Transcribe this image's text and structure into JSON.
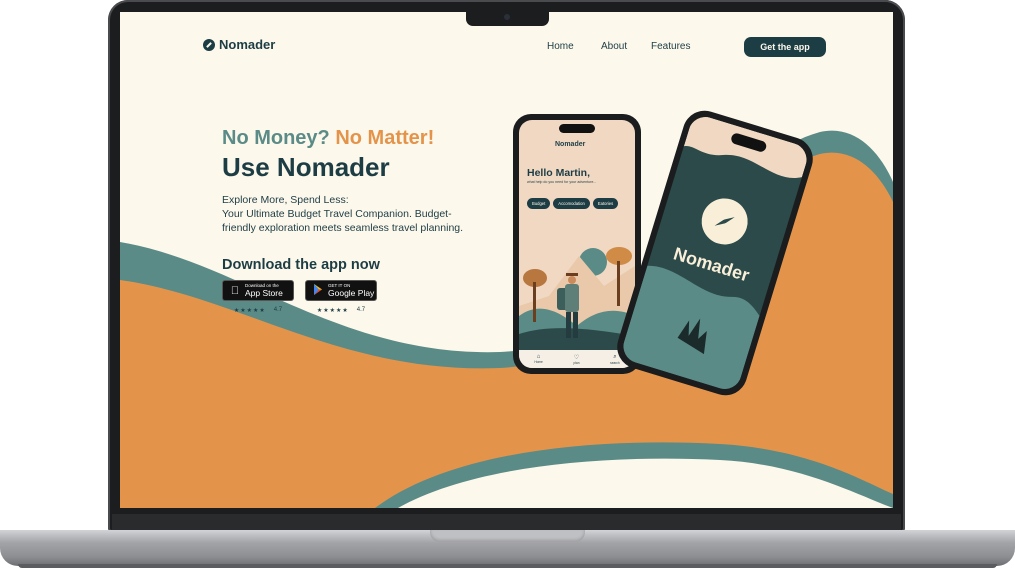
{
  "nav": {
    "brand": "Nomader",
    "links": [
      "Home",
      "About",
      "Features"
    ],
    "cta": "Get the app"
  },
  "hero": {
    "kicker_a": "No Money?",
    "kicker_b": "No Matter!",
    "headline": "Use Nomader",
    "desc_line1": "Explore More, Spend Less:",
    "desc_line2": "Your Ultimate Budget Travel Companion. Budget-friendly exploration meets seamless travel planning.",
    "download_title": "Download the app now",
    "stores": [
      {
        "small": "Download on the",
        "big": "App Store",
        "icon": "apple-icon",
        "stars": "★★★★★",
        "rating": "4.7"
      },
      {
        "small": "GET IT ON",
        "big": "Google Play",
        "icon": "google-play-icon",
        "stars": "★★★★★",
        "rating": "4.7"
      }
    ]
  },
  "phone_app": {
    "logo": "Nomader",
    "hello": "Hello Martin,",
    "sub": "what help do you need for your adventure...",
    "chips": [
      "Budget",
      "Accomodation",
      "Eatories"
    ],
    "tabs": [
      "Home",
      "plan",
      "search"
    ]
  },
  "phone_splash": {
    "title": "Nomader"
  },
  "colors": {
    "dark_teal": "#1d3d45",
    "teal": "#5b8b87",
    "orange": "#e4944a",
    "cream": "#fdf8ec"
  }
}
